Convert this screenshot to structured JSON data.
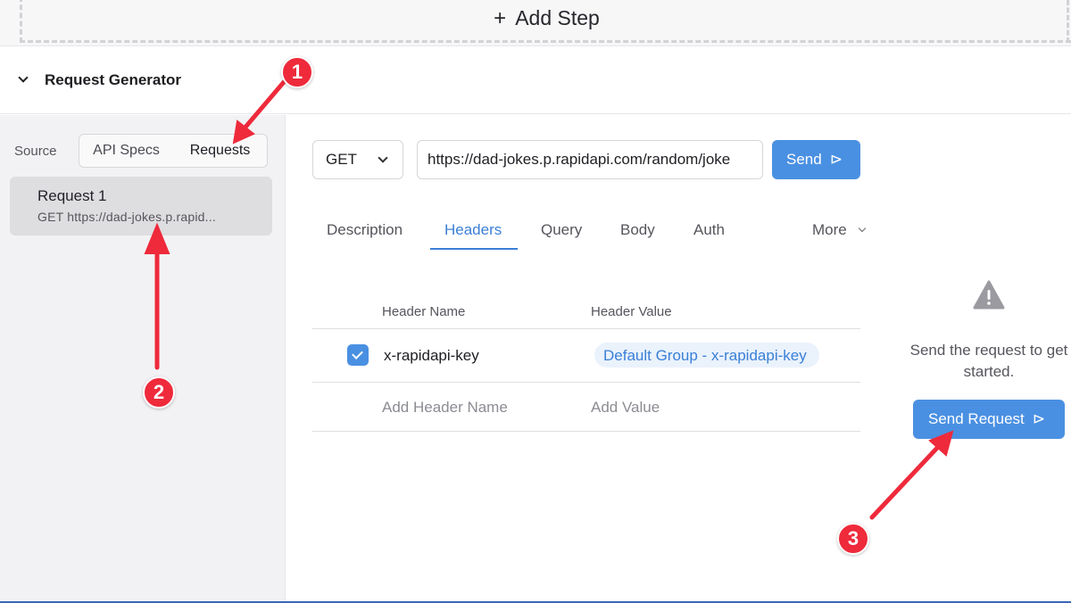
{
  "add_step": {
    "plus": "+",
    "label": "Add Step"
  },
  "section": {
    "title": "Request Generator"
  },
  "sidebar": {
    "source_label": "Source",
    "toggle": {
      "api_specs": "API Specs",
      "requests": "Requests"
    },
    "request_item": {
      "name": "Request 1",
      "subtitle": "GET https://dad-jokes.p.rapid..."
    }
  },
  "request_bar": {
    "method": "GET",
    "url": "https://dad-jokes.p.rapidapi.com/random/joke",
    "send_label": "Send",
    "send_glyph": "⊳"
  },
  "tabs": {
    "description": "Description",
    "headers": "Headers",
    "query": "Query",
    "body": "Body",
    "auth": "Auth",
    "more": "More"
  },
  "headers_table": {
    "col_name": "Header Name",
    "col_value": "Header Value",
    "rows": [
      {
        "enabled": true,
        "name": "x-rapidapi-key",
        "value": "Default Group - x-rapidapi-key"
      }
    ],
    "add_name_placeholder": "Add Header Name",
    "add_value_placeholder": "Add Value"
  },
  "empty_state": {
    "icon": "warning-icon",
    "message": "Send the request to get started.",
    "button_label": "Send Request"
  },
  "annotations": {
    "badge_1": "1",
    "badge_2": "2",
    "badge_3": "3"
  },
  "colors": {
    "accent": "#4a90e2",
    "tab_active": "#3a7fd6",
    "annotation": "#ee2a3b",
    "sidebar_bg": "#f2f2f4"
  }
}
